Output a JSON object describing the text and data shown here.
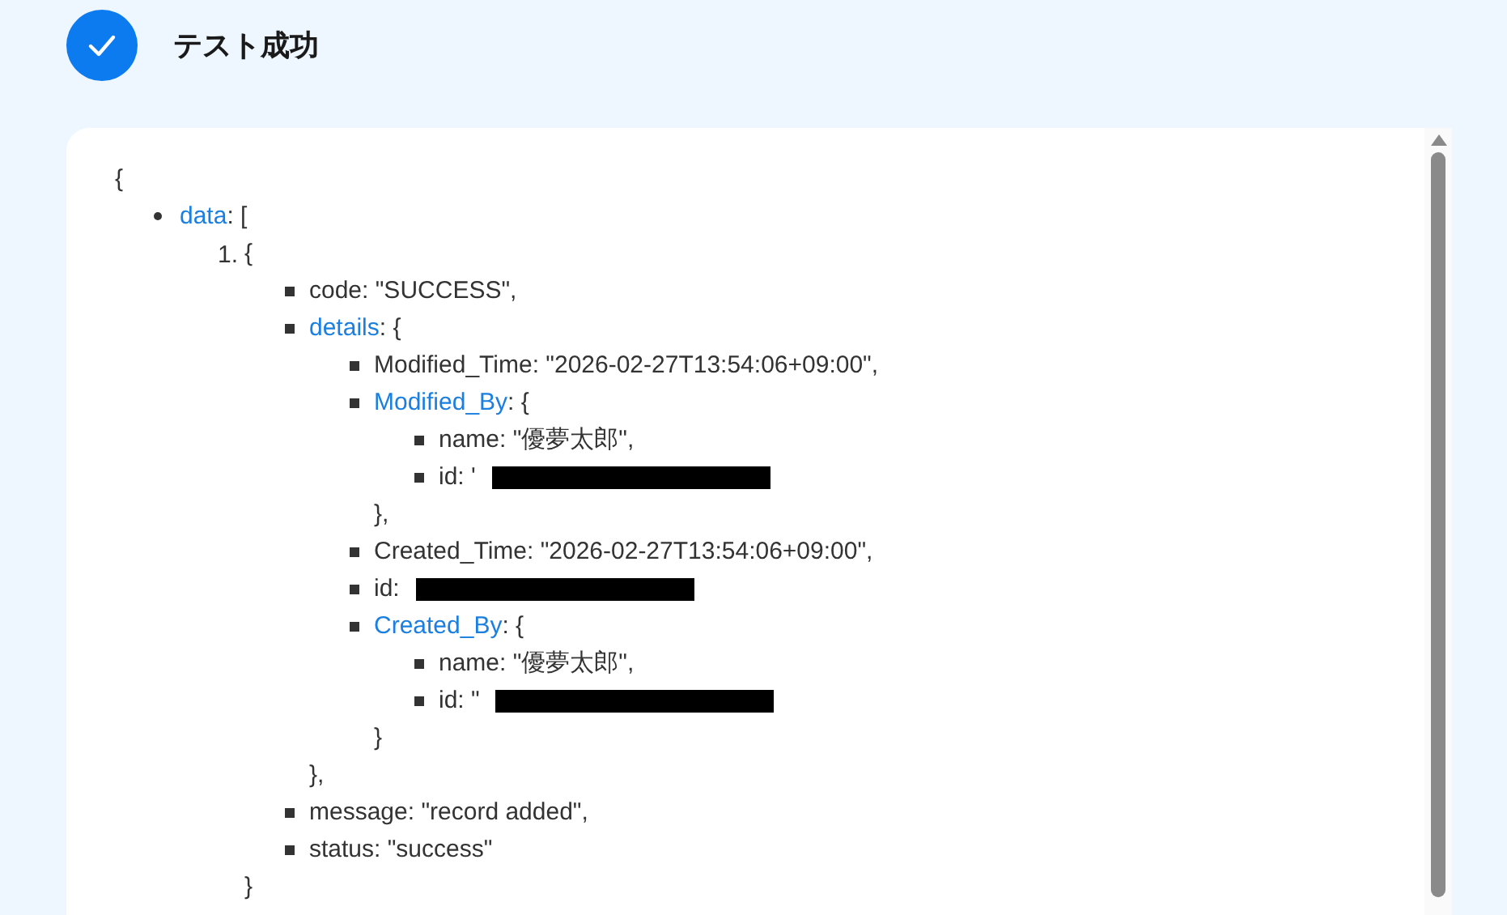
{
  "header": {
    "title": "テスト成功",
    "kind": "success"
  },
  "tree": {
    "text": "{",
    "children": [
      {
        "kind": "disc",
        "key": "data",
        "link": true,
        "text": ": [",
        "children": [
          {
            "kind": "number",
            "number": "1.",
            "text": "{",
            "close": "}",
            "children": [
              {
                "kind": "square",
                "text": "code: \"SUCCESS\","
              },
              {
                "kind": "square",
                "key": "details",
                "link": true,
                "text": ": {",
                "close": "},",
                "children": [
                  {
                    "kind": "square",
                    "text": "Modified_Time: \"2026-02-27T13:54:06+09:00\","
                  },
                  {
                    "kind": "square",
                    "key": "Modified_By",
                    "link": true,
                    "text": ": {",
                    "close": "},",
                    "children": [
                      {
                        "kind": "square",
                        "text": "name: \"優夢太郎\","
                      },
                      {
                        "kind": "square",
                        "text": "id: '",
                        "redacted": true
                      }
                    ]
                  },
                  {
                    "kind": "square",
                    "text": "Created_Time: \"2026-02-27T13:54:06+09:00\","
                  },
                  {
                    "kind": "square",
                    "text": "id:",
                    "redacted": true
                  },
                  {
                    "kind": "square",
                    "key": "Created_By",
                    "link": true,
                    "text": ": {",
                    "close": "}",
                    "children": [
                      {
                        "kind": "square",
                        "text": "name: \"優夢太郎\","
                      },
                      {
                        "kind": "square",
                        "text": "id: \"",
                        "redacted": true
                      }
                    ]
                  }
                ]
              },
              {
                "kind": "square",
                "text": "message: \"record added\","
              },
              {
                "kind": "square",
                "text": "status: \"success\""
              }
            ]
          }
        ]
      }
    ]
  }
}
